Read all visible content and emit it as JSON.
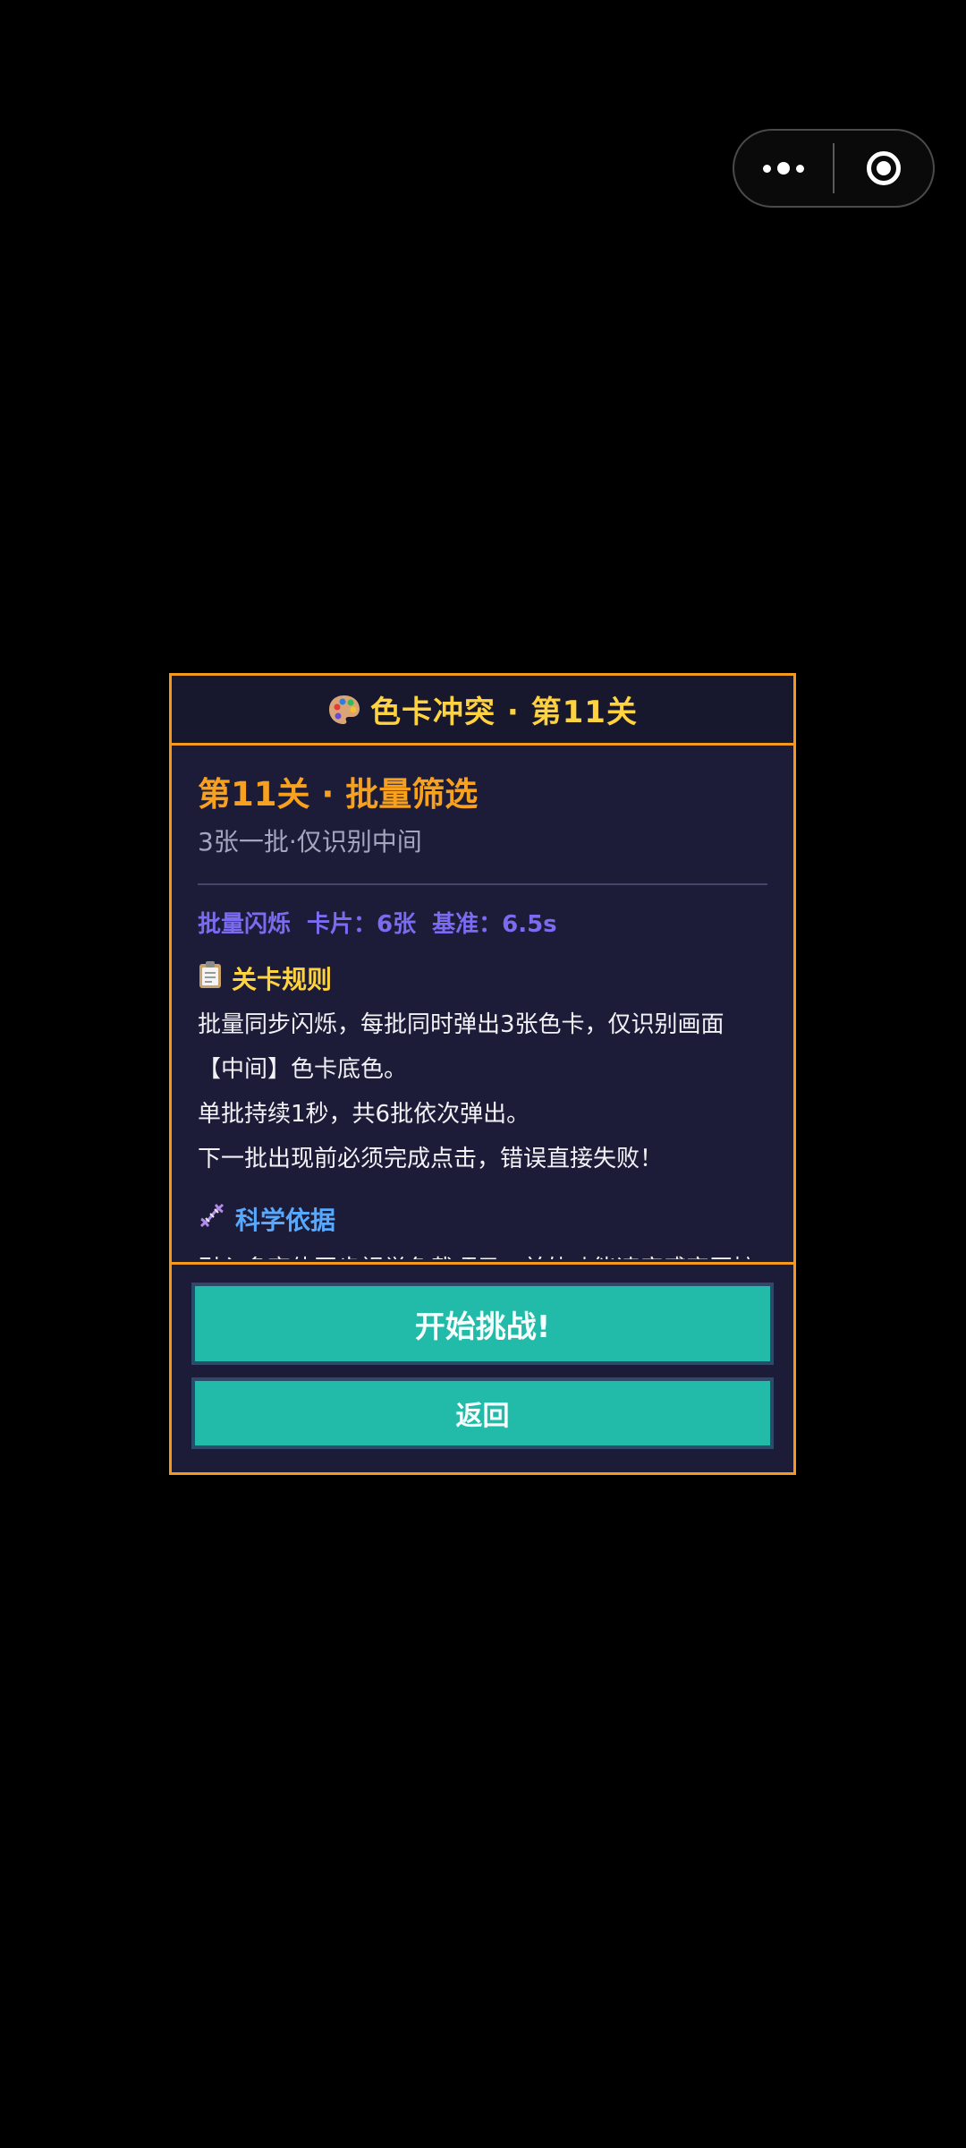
{
  "capsule": {
    "more_icon": "more-dots-icon",
    "close_icon": "target-close-icon"
  },
  "dialog": {
    "header_icon": "palette-icon",
    "header_title": "色卡冲突 · 第11关",
    "level_title": "第11关 · 批量筛选",
    "level_subtitle": "3张一批·仅识别中间",
    "stats": {
      "mode": "批量闪烁",
      "cards": "卡片：6张",
      "baseline": "基准：6.5s"
    },
    "rules": {
      "icon": "clipboard-icon",
      "heading": "关卡规则",
      "lines": [
        "批量同步闪烁，每批同时弹出3张色卡，仅识别画面【中间】色卡底色。",
        "单批持续1秒，共6批依次弹出。",
        "下一批出现前必须完成点击，错误直接失败！"
      ]
    },
    "science": {
      "icon": "dna-icon",
      "heading": "科学依据",
      "text": "引入多变体同步视觉负载项目，并轨功能速度感官区扩实体"
    },
    "buttons": {
      "start": "开始挑战!",
      "back": "返回"
    }
  }
}
